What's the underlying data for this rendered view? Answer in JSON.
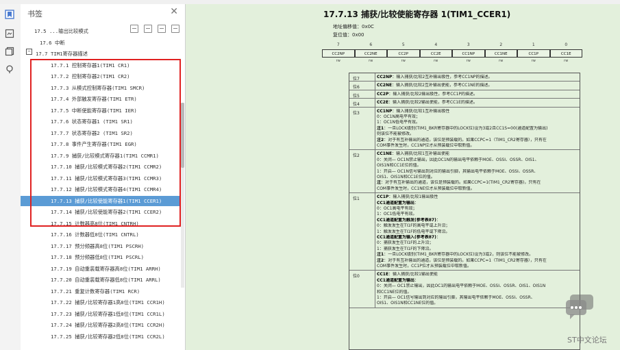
{
  "panel": {
    "title": "书签",
    "close": "✕",
    "tools": [
      "collapse-all",
      "expand-current",
      "expand-all",
      "bookmark-options"
    ]
  },
  "rail": {
    "icons": [
      "bookmark-icon",
      "thumbnail-icon",
      "copy-pages-icon",
      "search-icon"
    ]
  },
  "tree": [
    {
      "label": "17.5 ...输出比较模式",
      "indent": 20,
      "toggle": "",
      "cut": true
    },
    {
      "label": "17.6 中断",
      "indent": 28,
      "toggle": ""
    },
    {
      "label": "17.7 TIM1寄存器描述",
      "indent": 22,
      "toggle": "−"
    },
    {
      "label": "17.7.1 控制寄存器1(TIM1 CR1)",
      "indent": 44,
      "toggle": ""
    },
    {
      "label": "17.7.2 控制寄存器2(TIM1 CR2)",
      "indent": 44,
      "toggle": ""
    },
    {
      "label": "17.7.3 从模式控制寄存器(TIM1 SMCR)",
      "indent": 44,
      "toggle": ""
    },
    {
      "label": "17.7.4 外部触发寄存器(TIM1 ETR)",
      "indent": 44,
      "toggle": ""
    },
    {
      "label": "17.7.5 中断使能寄存器(TIM1 IER)",
      "indent": 44,
      "toggle": ""
    },
    {
      "label": "17.7.6 状态寄存器1 (TIM1 SR1)",
      "indent": 44,
      "toggle": ""
    },
    {
      "label": "17.7.7 状态寄存器2 (TIM1 SR2)",
      "indent": 44,
      "toggle": ""
    },
    {
      "label": "17.7.8 事件产生寄存器(TIM1 EGR)",
      "indent": 44,
      "toggle": ""
    },
    {
      "label": "17.7.9 捕获/比较模式寄存器1(TIM1 CCMR1)",
      "indent": 44,
      "toggle": ""
    },
    {
      "label": "17.7.10 捕获/比较模式寄存器2(TIM1 CCMR2)",
      "indent": 44,
      "toggle": ""
    },
    {
      "label": "17.7.11 捕获/比较模式寄存器3(TIM1 CCMR3)",
      "indent": 44,
      "toggle": ""
    },
    {
      "label": "17.7.12 捕获/比较模式寄存器4(TIM1 CCMR4)",
      "indent": 44,
      "toggle": ""
    },
    {
      "label": "17.7.13 捕获/比较使能寄存器1(TIM1 CCER1)",
      "indent": 44,
      "toggle": "",
      "selected": true
    },
    {
      "label": "17.7.14 捕获/比较使能寄存器2(TIM1 CCER2)",
      "indent": 44,
      "toggle": ""
    },
    {
      "label": "17.7.15 计数器高8位(TIM1 CNTRH)",
      "indent": 44,
      "toggle": ""
    },
    {
      "label": "17.7.16 计数器低8位(TIM1 CNTRL)",
      "indent": 44,
      "toggle": ""
    },
    {
      "label": "17.7.17 预分频器高8位(TIM1 PSCRH)",
      "indent": 44,
      "toggle": ""
    },
    {
      "label": "17.7.18 预分频器低8位(TIM1 PSCRL)",
      "indent": 44,
      "toggle": ""
    },
    {
      "label": "17.7.19 自动重装载寄存器高8位(TIM1 ARRH)",
      "indent": 44,
      "toggle": ""
    },
    {
      "label": "17.7.20 自动重装载寄存器低8位(TIM1 ARRL)",
      "indent": 44,
      "toggle": ""
    },
    {
      "label": "17.7.21 重复计数寄存器(TIM1 RCR)",
      "indent": 44,
      "toggle": ""
    },
    {
      "label": "17.7.22 捕获/比较寄存器1高8位(TIM1 CCR1H)",
      "indent": 44,
      "toggle": ""
    },
    {
      "label": "17.7.23 捕获/比较寄存器1低8位(TIM1 CCR1L)",
      "indent": 44,
      "toggle": ""
    },
    {
      "label": "17.7.24 捕获/比较寄存器2高8位(TIM1 CCR2H)",
      "indent": 44,
      "toggle": ""
    },
    {
      "label": "17.7.25 捕获/比较寄存器2低8位(TIM1 CCR2L)",
      "indent": 44,
      "toggle": ""
    }
  ],
  "doc": {
    "title": "17.7.13 捕获/比较使能寄存器 1(TIM1_CCER1)",
    "offset": "地址偏移值：0x0C",
    "reset": "复位值：0x00",
    "bit_numbers": [
      "7",
      "6",
      "5",
      "4",
      "3",
      "2",
      "1",
      "0"
    ],
    "bit_fields": [
      "CC2NP",
      "CC2NE",
      "CC2P",
      "CC2E",
      "CC1NP",
      "CC1NE",
      "CC1P",
      "CC1E"
    ],
    "bit_access": [
      "rw",
      "rw",
      "rw",
      "rw",
      "rw",
      "rw",
      "rw",
      "rw"
    ],
    "rows": [
      {
        "bit": "位7",
        "lines": [
          "<b>CC2NP</b>：输入捕获/比较2互补输出极性，参考CC1NP的描述。"
        ]
      },
      {
        "bit": "位6",
        "lines": [
          "<b>CC2NE</b>：输入捕获/比较2互补输出使能，参考CC1NE的描述。"
        ]
      },
      {
        "bit": "位5",
        "lines": [
          "<b>CC2P</b>：输入捕获/比较2输出极性，参考CC1P的描述。"
        ]
      },
      {
        "bit": "位4",
        "lines": [
          "<b>CC2E</b>：输入捕获/比较2输出使能，参考CC1E的描述。"
        ]
      },
      {
        "bit": "位3",
        "lines": [
          "<b>CC1NP</b>：输入捕获/比较1互补输出极性",
          "0：OC1N高电平有效；",
          "1：OC1N低电平有效。",
          "<b>注1</b>：一旦LOCK级别(TIM1_BKR寄存器中的LOCK位)设为3或2且CC1S=00(通道配置为输出)",
          "则该位不能被修改。",
          "<b>注2</b>：对于有互补输出的通道，该位是预装载的。如果CCPC=1（TIM1_CR2寄存器），只有在",
          "COM事件发生时，CC1NP位才从预装载位中取新值。"
        ]
      },
      {
        "bit": "位2",
        "lines": [
          "<b>CC1NE</b>：输入捕获/比较1互补输出使能",
          "0：关闭— OC1N禁止输出，因此OC1N的输出电平依赖于MOE、OSSI、OSSR、OIS1、",
          "OIS1N和CC1E位的值。",
          "1：开启— OC1N信号输出到对应的输出引脚，其输出电平依赖于MOE、OSSI、OSSR、",
          "OIS1、OIS1N和CC1E位的值。",
          "<b>注</b>：对于有互补输出的通道，该位是预装载的。如果CCPC=1(TIM1_CR2寄存器)，只有在",
          "COM事件发生时，CC1NE位才从预装载位中取新值。"
        ]
      },
      {
        "bit": "位1",
        "lines": [
          "<b>CC1P</b>：输入捕获/比较1输出极性",
          "<b>CC1通道配置为输出</b>：",
          "0：OC1高电平有效；",
          "1：OC1低电平有效。",
          "<b>CC1通道配置为触发(参考表87)</b>：",
          "0：触发发生在TI1F的高电平或上升沿；",
          "1：触发发生在TI1F的低电平或下降沿。",
          "<b>CC1通道配置为输入(参考表87)</b>：",
          "0：捕获发生在TI1F的上升沿；",
          "1：捕获发生在TI1F的下降沿。",
          "<b>注1</b>：一旦LOCK级别(TIM1_BKR寄存器中的LOCK位)设为3或2，则该位不能被修改。",
          "<b>注2</b>：对于有互补输出的通道，该位是预装载的。如果CCPC=1（TIM1_CR2寄存器），只有在",
          "COM事件发生时，CC1P位才从预装载位中取新值。"
        ]
      },
      {
        "bit": "位0",
        "lines": [
          "<b>CC1E</b>：输入捕获/比较1输出使能",
          "<b>CC1通道配置为输出</b>：",
          "0：关闭— OC1禁止输出，因此OC1的输出电平依赖于MOE、OSSI、OSSR、OIS1、OIS1N",
          "和CC1NE位的值。",
          "1：开启— OC1信号输出到对应的输出引脚，其输出电平依赖于MOE、OSSI、OSSR、",
          "OIS1、OIS1N和CC1NE位的值。"
        ]
      }
    ]
  },
  "watermark": {
    "text": "ST中文论坛"
  }
}
